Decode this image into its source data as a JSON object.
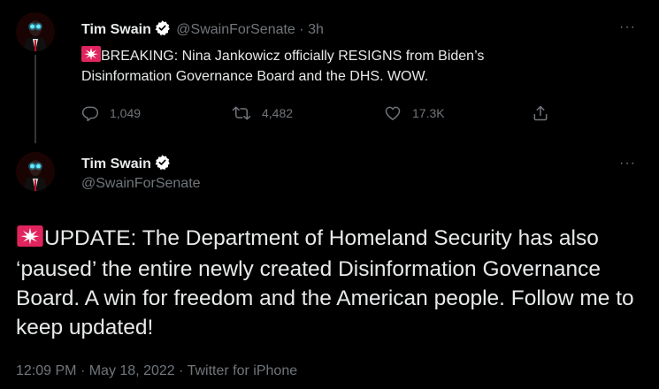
{
  "tweet1": {
    "author_name": "Tim Swain",
    "handle": "@SwainForSenate",
    "separator": "·",
    "time": "3h",
    "more": "···",
    "text": "BREAKING: Nina Jankowicz officially RESIGNS from Biden’s Disinformation Governance Board and the DHS. WOW.",
    "actions": {
      "replies": "1,049",
      "retweets": "4,482",
      "likes": "17.3K"
    }
  },
  "tweet2": {
    "author_name": "Tim Swain",
    "handle": "@SwainForSenate",
    "more": "···",
    "text": "UPDATE: The Department of Homeland Security has also ‘paused’ the entire newly created Disinformation Governance Board. A win for freedom and the American people. Follow me to keep updated!",
    "time": "12:09 PM",
    "date": "May 18, 2022",
    "source": "Twitter for iPhone",
    "separator": "·"
  },
  "colors": {
    "background": "#000000",
    "text": "#e7e9ea",
    "muted": "#71767b",
    "verified": "#ffffff",
    "siren": "#e0245e"
  },
  "icons": [
    "verified-badge-icon",
    "siren-icon",
    "reply-icon",
    "retweet-icon",
    "like-icon",
    "share-icon",
    "more-icon"
  ]
}
